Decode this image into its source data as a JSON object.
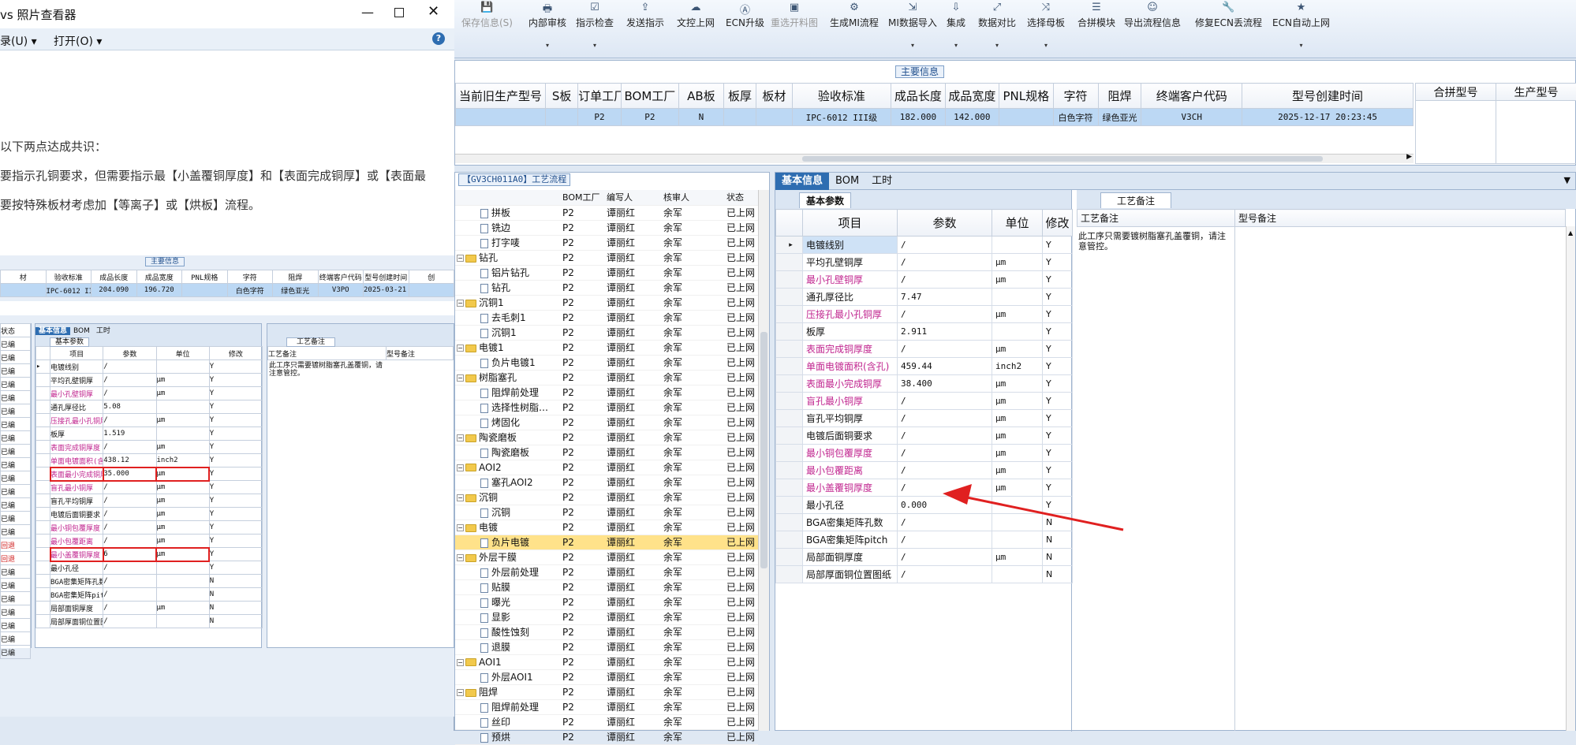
{
  "toolbar": {
    "items": [
      {
        "label": "保存信息(S)",
        "icon": "save-icon",
        "disabled": true
      },
      {
        "label": "内部审核",
        "icon": "printer-icon",
        "dropdown": true
      },
      {
        "label": "指示检查",
        "icon": "check-icon",
        "dropdown": true
      },
      {
        "label": "发送指示",
        "icon": "send-icon"
      },
      {
        "label": "文控上网",
        "icon": "cloud-upload-icon"
      },
      {
        "label": "ECN升级",
        "icon": "ecn-icon"
      },
      {
        "label": "重选开料图",
        "icon": "image-icon",
        "disabled": true
      },
      {
        "label": "生成MI流程",
        "icon": "flow-icon"
      },
      {
        "label": "MI数据导入",
        "icon": "import-icon",
        "dropdown": true
      },
      {
        "label": "集成",
        "icon": "download-icon",
        "dropdown": true
      },
      {
        "label": "数据对比",
        "icon": "compare-icon",
        "dropdown": true
      },
      {
        "label": "选择母板",
        "icon": "shuffle-icon",
        "dropdown": true
      },
      {
        "label": "合拼模块",
        "icon": "list-icon"
      },
      {
        "label": "导出流程信息",
        "icon": "smile-icon"
      },
      {
        "label": "修复ECN丢流程",
        "icon": "wrench-icon"
      },
      {
        "label": "ECN自动上网",
        "icon": "star-icon",
        "dropdown": true
      }
    ]
  },
  "main_info": {
    "title": "主要信息",
    "headers": [
      "当前旧生产型号",
      "S板",
      "订单工厂",
      "BOM工厂",
      "AB板",
      "板厚",
      "板材",
      "验收标准",
      "成品长度",
      "成品宽度",
      "PNL规格",
      "字符",
      "阻焊",
      "终端客户代码",
      "型号创建时间"
    ],
    "row": [
      "",
      "",
      "P2",
      "P2",
      "N",
      "",
      "",
      "IPC-6012 III级",
      "182.000",
      "142.000",
      "",
      "白色字符",
      "绿色亚光",
      "V3CH",
      "2025-12-17 20:23:45"
    ],
    "right_headers": [
      "合拼型号",
      "生产型号"
    ]
  },
  "flow": {
    "title": "【GV3CH011A0】工艺流程",
    "headers": [
      "流程",
      "BOM工厂",
      "编写人",
      "核审人",
      "状态"
    ],
    "rows": [
      {
        "name": "拼板",
        "level": 2,
        "type": "doc",
        "bom": "P2",
        "w": "谭丽红",
        "r": "余军",
        "s": "已上网"
      },
      {
        "name": "铣边",
        "level": 2,
        "type": "doc",
        "bom": "P2",
        "w": "谭丽红",
        "r": "余军",
        "s": "已上网"
      },
      {
        "name": "打字唛",
        "level": 2,
        "type": "doc",
        "bom": "P2",
        "w": "谭丽红",
        "r": "余军",
        "s": "已上网"
      },
      {
        "name": "钻孔",
        "level": 1,
        "type": "folder",
        "bom": "P2",
        "w": "谭丽红",
        "r": "余军",
        "s": "已上网"
      },
      {
        "name": "铝片钻孔",
        "level": 2,
        "type": "doc",
        "bom": "P2",
        "w": "谭丽红",
        "r": "余军",
        "s": "已上网"
      },
      {
        "name": "钻孔",
        "level": 2,
        "type": "doc",
        "bom": "P2",
        "w": "谭丽红",
        "r": "余军",
        "s": "已上网"
      },
      {
        "name": "沉铜1",
        "level": 1,
        "type": "folder",
        "bom": "P2",
        "w": "谭丽红",
        "r": "余军",
        "s": "已上网"
      },
      {
        "name": "去毛刺1",
        "level": 2,
        "type": "doc",
        "bom": "P2",
        "w": "谭丽红",
        "r": "余军",
        "s": "已上网"
      },
      {
        "name": "沉铜1",
        "level": 2,
        "type": "doc",
        "bom": "P2",
        "w": "谭丽红",
        "r": "余军",
        "s": "已上网"
      },
      {
        "name": "电镀1",
        "level": 1,
        "type": "folder",
        "bom": "P2",
        "w": "谭丽红",
        "r": "余军",
        "s": "已上网"
      },
      {
        "name": "负片电镀1",
        "level": 2,
        "type": "doc",
        "bom": "P2",
        "w": "谭丽红",
        "r": "余军",
        "s": "已上网"
      },
      {
        "name": "树脂塞孔",
        "level": 1,
        "type": "folder",
        "bom": "P2",
        "w": "谭丽红",
        "r": "余军",
        "s": "已上网"
      },
      {
        "name": "阻焊前处理",
        "level": 2,
        "type": "doc",
        "bom": "P2",
        "w": "谭丽红",
        "r": "余军",
        "s": "已上网"
      },
      {
        "name": "选择性树脂…",
        "level": 2,
        "type": "doc",
        "bom": "P2",
        "w": "谭丽红",
        "r": "余军",
        "s": "已上网"
      },
      {
        "name": "烤固化",
        "level": 2,
        "type": "doc",
        "bom": "P2",
        "w": "谭丽红",
        "r": "余军",
        "s": "已上网"
      },
      {
        "name": "陶瓷磨板",
        "level": 1,
        "type": "folder",
        "bom": "P2",
        "w": "谭丽红",
        "r": "余军",
        "s": "已上网"
      },
      {
        "name": "陶瓷磨板",
        "level": 2,
        "type": "doc",
        "bom": "P2",
        "w": "谭丽红",
        "r": "余军",
        "s": "已上网"
      },
      {
        "name": "AOI2",
        "level": 1,
        "type": "folder",
        "bom": "P2",
        "w": "谭丽红",
        "r": "余军",
        "s": "已上网"
      },
      {
        "name": "塞孔AOI2",
        "level": 2,
        "type": "doc",
        "bom": "P2",
        "w": "谭丽红",
        "r": "余军",
        "s": "已上网"
      },
      {
        "name": "沉铜",
        "level": 1,
        "type": "folder",
        "bom": "P2",
        "w": "谭丽红",
        "r": "余军",
        "s": "已上网"
      },
      {
        "name": "沉铜",
        "level": 2,
        "type": "doc",
        "bom": "P2",
        "w": "谭丽红",
        "r": "余军",
        "s": "已上网"
      },
      {
        "name": "电镀",
        "level": 1,
        "type": "folder",
        "bom": "P2",
        "w": "谭丽红",
        "r": "余军",
        "s": "已上网"
      },
      {
        "name": "负片电镀",
        "level": 2,
        "type": "doc",
        "bom": "P2",
        "w": "谭丽红",
        "r": "余军",
        "s": "已上网",
        "selected": true
      },
      {
        "name": "外层干膜",
        "level": 1,
        "type": "folder",
        "bom": "P2",
        "w": "谭丽红",
        "r": "余军",
        "s": "已上网"
      },
      {
        "name": "外层前处理",
        "level": 2,
        "type": "doc",
        "bom": "P2",
        "w": "谭丽红",
        "r": "余军",
        "s": "已上网"
      },
      {
        "name": "贴膜",
        "level": 2,
        "type": "doc",
        "bom": "P2",
        "w": "谭丽红",
        "r": "余军",
        "s": "已上网"
      },
      {
        "name": "曝光",
        "level": 2,
        "type": "doc",
        "bom": "P2",
        "w": "谭丽红",
        "r": "余军",
        "s": "已上网"
      },
      {
        "name": "显影",
        "level": 2,
        "type": "doc",
        "bom": "P2",
        "w": "谭丽红",
        "r": "余军",
        "s": "已上网"
      },
      {
        "name": "酸性蚀刻",
        "level": 2,
        "type": "doc",
        "bom": "P2",
        "w": "谭丽红",
        "r": "余军",
        "s": "已上网"
      },
      {
        "name": "退膜",
        "level": 2,
        "type": "doc",
        "bom": "P2",
        "w": "谭丽红",
        "r": "余军",
        "s": "已上网"
      },
      {
        "name": "AOI1",
        "level": 1,
        "type": "folder",
        "bom": "P2",
        "w": "谭丽红",
        "r": "余军",
        "s": "已上网"
      },
      {
        "name": "外层AOI1",
        "level": 2,
        "type": "doc",
        "bom": "P2",
        "w": "谭丽红",
        "r": "余军",
        "s": "已上网"
      },
      {
        "name": "阻焊",
        "level": 1,
        "type": "folder",
        "bom": "P2",
        "w": "谭丽红",
        "r": "余军",
        "s": "已上网"
      },
      {
        "name": "阻焊前处理",
        "level": 2,
        "type": "doc",
        "bom": "P2",
        "w": "谭丽红",
        "r": "余军",
        "s": "已上网"
      },
      {
        "name": "丝印",
        "level": 2,
        "type": "doc",
        "bom": "P2",
        "w": "谭丽红",
        "r": "余军",
        "s": "已上网"
      },
      {
        "name": "预烘",
        "level": 2,
        "type": "doc",
        "bom": "P2",
        "w": "谭丽红",
        "r": "余军",
        "s": "已上网"
      }
    ]
  },
  "tabs": [
    "基本信息",
    "BOM",
    "工时"
  ],
  "basic": {
    "subtab": "基本参数",
    "headers": [
      "项目",
      "参数",
      "单位",
      "修改"
    ],
    "rows": [
      {
        "item": "电镀线别",
        "param": "/",
        "unit": "",
        "mod": "Y",
        "pink": false
      },
      {
        "item": "平均孔壁铜厚",
        "param": "/",
        "unit": "μm",
        "mod": "Y",
        "pink": false
      },
      {
        "item": "最小孔壁铜厚",
        "param": "/",
        "unit": "μm",
        "mod": "Y",
        "pink": true
      },
      {
        "item": "通孔厚径比",
        "param": "7.47",
        "unit": "",
        "mod": "Y",
        "pink": false
      },
      {
        "item": "压接孔最小孔铜厚",
        "param": "/",
        "unit": "μm",
        "mod": "Y",
        "pink": true
      },
      {
        "item": "板厚",
        "param": "2.911",
        "unit": "",
        "mod": "Y",
        "pink": false
      },
      {
        "item": "表面完成铜厚度",
        "param": "/",
        "unit": "μm",
        "mod": "Y",
        "pink": true
      },
      {
        "item": "单面电镀面积(含孔)",
        "param": "459.44",
        "unit": "inch2",
        "mod": "Y",
        "pink": true
      },
      {
        "item": "表面最小完成铜厚",
        "param": "38.400",
        "unit": "μm",
        "mod": "Y",
        "pink": true
      },
      {
        "item": "盲孔最小铜厚",
        "param": "/",
        "unit": "μm",
        "mod": "Y",
        "pink": true
      },
      {
        "item": "盲孔平均铜厚",
        "param": "/",
        "unit": "μm",
        "mod": "Y",
        "pink": false
      },
      {
        "item": "电镀后面铜要求",
        "param": "/",
        "unit": "μm",
        "mod": "Y",
        "pink": false
      },
      {
        "item": "最小铜包覆厚度",
        "param": "/",
        "unit": "μm",
        "mod": "Y",
        "pink": true
      },
      {
        "item": "最小包覆距离",
        "param": "/",
        "unit": "μm",
        "mod": "Y",
        "pink": true
      },
      {
        "item": "最小盖覆铜厚度",
        "param": "/",
        "unit": "μm",
        "mod": "Y",
        "pink": true
      },
      {
        "item": "最小孔径",
        "param": "0.000",
        "unit": "",
        "mod": "Y",
        "pink": false
      },
      {
        "item": "BGA密集矩阵孔数",
        "param": "/",
        "unit": "",
        "mod": "N",
        "pink": false
      },
      {
        "item": "BGA密集矩阵pitch",
        "param": "/",
        "unit": "",
        "mod": "N",
        "pink": false
      },
      {
        "item": "局部面铜厚度",
        "param": "/",
        "unit": "μm",
        "mod": "N",
        "pink": false
      },
      {
        "item": "局部厚面铜位置图纸",
        "param": "/",
        "unit": "",
        "mod": "N",
        "pink": false
      }
    ]
  },
  "process_notes": {
    "tab": "工艺备注",
    "headers": [
      "工艺备注",
      "型号备注"
    ],
    "note": "此工序只需要镀树脂塞孔盖覆铜，请注意管控。"
  },
  "photo_viewer": {
    "title": "vs 照片查看器",
    "menu": [
      "录(U)",
      "打开(O)"
    ],
    "text_lines": [
      "以下两点达成共识：",
      "要指示孔铜要求，但需要指示最【小盖覆铜厚度】和【表面完成铜厚】或【表面最",
      "要按特殊板材考虑加【等离子】或【烘板】流程。"
    ],
    "mini": {
      "main_title": "主要信息",
      "headers": [
        "材",
        "验收标准",
        "成品长度",
        "成品宽度",
        "PNL规格",
        "字符",
        "阻焊",
        "终端客户代码",
        "型号创建时间",
        "创"
      ],
      "row": [
        "",
        "IPC-6012 II级",
        "204.090",
        "196.720",
        "",
        "白色字符",
        "绿色亚光",
        "V3PO",
        "2025-03-21 14:27:20",
        ""
      ],
      "tabs": [
        "基本信息",
        "BOM",
        "工时"
      ],
      "subtab": "基本参数",
      "param_headers": [
        "项目",
        "参数",
        "单位",
        "修改"
      ],
      "params": [
        {
          "item": "电镀线别",
          "param": "/",
          "unit": "",
          "mod": "Y",
          "pink": false
        },
        {
          "item": "平均孔壁铜厚",
          "param": "/",
          "unit": "μm",
          "mod": "Y",
          "pink": false
        },
        {
          "item": "最小孔壁铜厚",
          "param": "/",
          "unit": "μm",
          "mod": "Y",
          "pink": true
        },
        {
          "item": "通孔厚径比",
          "param": "5.08",
          "unit": "",
          "mod": "Y",
          "pink": false
        },
        {
          "item": "压接孔最小孔铜厚",
          "param": "/",
          "unit": "μm",
          "mod": "Y",
          "pink": true
        },
        {
          "item": "板厚",
          "param": "1.519",
          "unit": "",
          "mod": "Y",
          "pink": false
        },
        {
          "item": "表面完成铜厚度",
          "param": "/",
          "unit": "μm",
          "mod": "Y",
          "pink": true
        },
        {
          "item": "单面电镀面积(含孔)",
          "param": "438.12",
          "unit": "inch2",
          "mod": "Y",
          "pink": true
        },
        {
          "item": "表面最小完成铜厚",
          "param": "35.000",
          "unit": "μm",
          "mod": "Y",
          "pink": true,
          "boxed": true
        },
        {
          "item": "盲孔最小铜厚",
          "param": "/",
          "unit": "μm",
          "mod": "Y",
          "pink": true
        },
        {
          "item": "盲孔平均铜厚",
          "param": "/",
          "unit": "μm",
          "mod": "Y",
          "pink": false
        },
        {
          "item": "电镀后面铜要求",
          "param": "/",
          "unit": "μm",
          "mod": "Y",
          "pink": false
        },
        {
          "item": "最小铜包覆厚度",
          "param": "/",
          "unit": "μm",
          "mod": "Y",
          "pink": true
        },
        {
          "item": "最小包覆距离",
          "param": "/",
          "unit": "μm",
          "mod": "Y",
          "pink": true
        },
        {
          "item": "最小盖覆铜厚度",
          "param": "6",
          "unit": "μm",
          "mod": "Y",
          "pink": true,
          "boxed": true
        },
        {
          "item": "最小孔径",
          "param": "/",
          "unit": "",
          "mod": "Y",
          "pink": false
        },
        {
          "item": "BGA密集矩阵孔数",
          "param": "/",
          "unit": "",
          "mod": "N",
          "pink": false
        },
        {
          "item": "BGA密集矩阵pitch",
          "param": "/",
          "unit": "",
          "mod": "N",
          "pink": false
        },
        {
          "item": "局部面铜厚度",
          "param": "/",
          "unit": "μm",
          "mod": "N",
          "pink": false
        },
        {
          "item": "局部厚面铜位置图纸",
          "param": "/",
          "unit": "",
          "mod": "N",
          "pink": false
        }
      ],
      "state_header": "状态",
      "states": [
        "已编",
        "已编",
        "已编",
        "已编",
        "已编",
        "已编",
        "已编",
        "已编",
        "已编",
        "已编",
        "已编",
        "已编",
        "已编",
        "已编",
        "已编",
        "回退",
        "回退",
        "已编",
        "已编",
        "已编",
        "已编",
        "已编",
        "已编",
        "已编"
      ],
      "notes_tab": "工艺备注",
      "notes_headers": [
        "工艺备注",
        "型号备注"
      ],
      "note": "此工序只需要镀树脂塞孔盖覆铜，请注意管控。"
    }
  },
  "colors": {
    "accent": "#2e6db1",
    "pink": "#c0258f",
    "arrow": "#e02020",
    "highlight_box": "#e02020",
    "selected_row": "#bcd8f4",
    "selected_tree": "#ffe28a"
  }
}
